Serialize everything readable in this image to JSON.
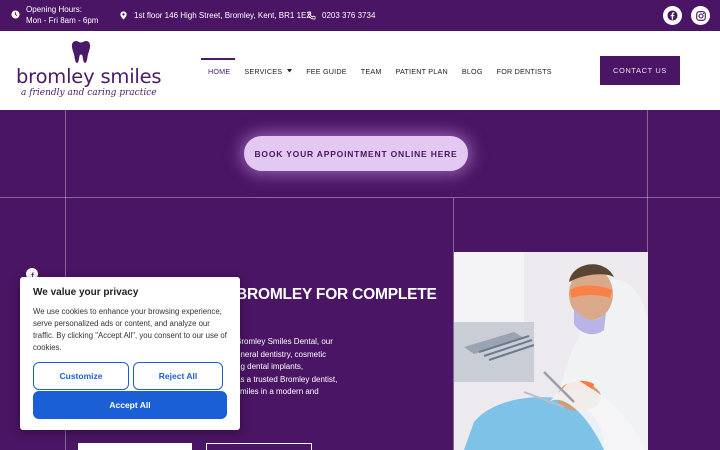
{
  "topbar": {
    "hours_label": "Opening Hours:",
    "hours_value": "Mon - Fri 8am - 6pm",
    "address": "1st floor 146 High Street, Bromley, Kent, BR1 1EZ",
    "phone": "0203 376 3734"
  },
  "header": {
    "logo_name": "bromley smiles",
    "logo_tagline": "a friendly and caring practice",
    "nav": [
      "HOME",
      "SERVICES",
      "FEE GUIDE",
      "TEAM",
      "PATIENT PLAN",
      "BLOG",
      "FOR DENTISTS"
    ],
    "contact_label": "CONTACT US"
  },
  "hero": {
    "book_label": "BOOK YOUR APPOINTMENT ONLINE HERE"
  },
  "content": {
    "heading": "BROMLEY FOR COMPLETE",
    "para_lines": [
      "Bromley Smiles Dental, our",
      "eneral dentistry, cosmetic",
      "ng dental implants,",
      "as a trusted Bromley dentist,",
      "smiles in a modern and"
    ]
  },
  "cookie": {
    "title": "We value your privacy",
    "text_lines": [
      "We use cookies to enhance your browsing experience,",
      "serve personalized ads or content, and analyze our",
      "traffic. By clicking \"Accept All\", you consent to our use of",
      "cookies."
    ],
    "customize_label": "Customize",
    "reject_label": "Reject All",
    "accept_label": "Accept All"
  },
  "colors": {
    "brand_purple": "#4a1564",
    "accent_lilac": "#e3c8f2",
    "cookie_blue": "#1a5fd6"
  },
  "icons": [
    "clock-icon",
    "location-pin-icon",
    "phone-icon",
    "facebook-icon",
    "instagram-icon",
    "tooth-logo-icon",
    "chevron-down-icon"
  ]
}
